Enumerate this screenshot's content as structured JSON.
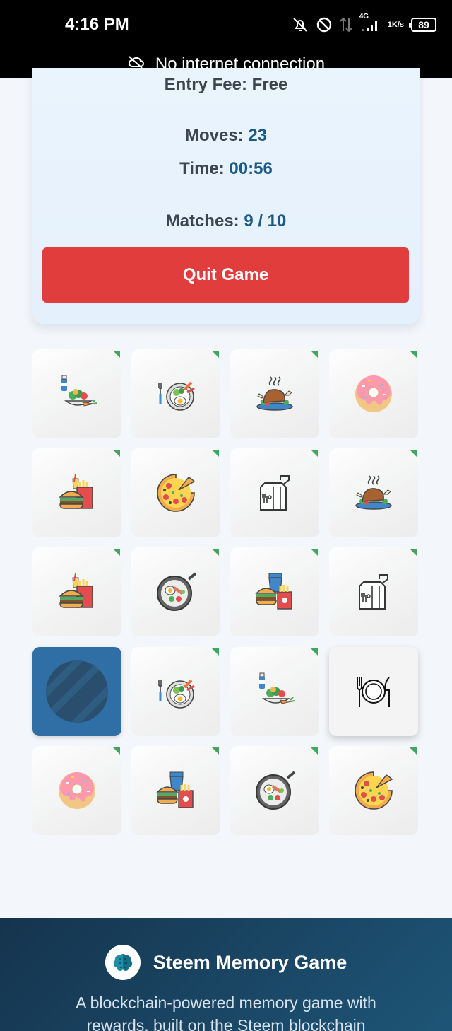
{
  "status_bar": {
    "time": "4:16 PM",
    "network_type": "4G",
    "net_speed_value": "1",
    "net_speed_unit": "K/s",
    "battery": "89"
  },
  "network_banner": {
    "text": "No internet connection",
    "icon": "cloud-off-icon"
  },
  "game_info": {
    "entry_fee": "Entry Fee: Free",
    "moves_label": "Moves:",
    "moves_value": "23",
    "time_label": "Time:",
    "time_value": "00:56",
    "matches_label": "Matches:",
    "matches_value": "9 / 10",
    "quit_label": "Quit Game"
  },
  "board": {
    "columns": 4,
    "rows": 5,
    "cards": [
      {
        "icon": "salad-drink-icon",
        "state": "matched"
      },
      {
        "icon": "plate-egg-icon",
        "state": "matched"
      },
      {
        "icon": "roast-chicken-icon",
        "state": "matched"
      },
      {
        "icon": "donut-icon",
        "state": "matched"
      },
      {
        "icon": "fast-food-icon",
        "state": "matched"
      },
      {
        "icon": "pizza-icon",
        "state": "matched"
      },
      {
        "icon": "takeaway-bag-icon",
        "state": "matched"
      },
      {
        "icon": "roast-chicken-icon",
        "state": "matched"
      },
      {
        "icon": "fast-food-icon",
        "state": "matched"
      },
      {
        "icon": "pan-breakfast-icon",
        "state": "matched"
      },
      {
        "icon": "burger-combo-icon",
        "state": "matched"
      },
      {
        "icon": "takeaway-bag-icon",
        "state": "matched"
      },
      {
        "icon": "card-back-icon",
        "state": "hidden"
      },
      {
        "icon": "plate-egg-icon",
        "state": "matched"
      },
      {
        "icon": "salad-drink-icon",
        "state": "matched"
      },
      {
        "icon": "plate-cutlery-icon",
        "state": "revealed"
      },
      {
        "icon": "donut-icon",
        "state": "matched"
      },
      {
        "icon": "burger-combo-icon",
        "state": "matched"
      },
      {
        "icon": "pan-breakfast-icon",
        "state": "matched"
      },
      {
        "icon": "pizza-icon",
        "state": "matched"
      }
    ],
    "colors": {
      "hidden_card": "#2f6fa6",
      "match_marker": "#2f9e4f"
    }
  },
  "footer": {
    "title": "Steem Memory Game",
    "logo_icon": "brain-logo-icon",
    "tagline": "A blockchain-powered memory game with rewards, built on the Steem blockchain"
  },
  "colors": {
    "quit_button": "#e23d3d",
    "value_text": "#1c5a86",
    "footer_bg": "#15344e"
  }
}
